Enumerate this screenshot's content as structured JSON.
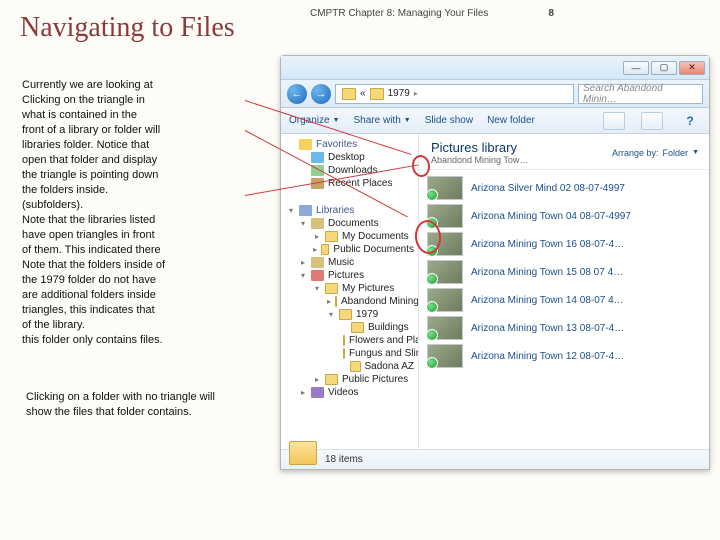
{
  "slide": {
    "chapter": "CMPTR Chapter 8: Managing Your Files",
    "page": "8",
    "title": "Navigating to Files",
    "para1": "Currently we are looking at\nClicking on the triangle in\nwhat is contained in the\nfront of a library or folder will\nlibraries folder. Notice that\nopen that folder and display\nthe triangle is pointing down\nthe folders inside.\n(subfolders).\nNote that the libraries listed\nhave open triangles in front\nof them. This indicated there\nNote that the folders inside of\nthe 1979 folder do not have\nare additional folders inside\ntriangles, this indicates that\nof the library.\nthis folder only contains files.",
    "para2": "Clicking on a folder with no triangle will show the files that folder contains."
  },
  "explorer": {
    "win_buttons": {
      "min": "—",
      "max": "▢",
      "close": "✕"
    },
    "nav": {
      "back": "←",
      "fwd": "→"
    },
    "breadcrumb": {
      "seg1": "«",
      "seg2": "1979",
      "sep": "▸"
    },
    "search_placeholder": "Search Abandond Minin…",
    "toolbar": {
      "organize": "Organize",
      "share": "Share with",
      "slideshow": "Slide show",
      "newfolder": "New folder"
    },
    "library": {
      "title": "Pictures library",
      "subtitle": "Abandond Mining Tow…",
      "arrange_label": "Arrange by:",
      "arrange_value": "Folder"
    },
    "tree": {
      "favorites": "Favorites",
      "desktop": "Desktop",
      "downloads": "Downloads",
      "recent": "Recent Places",
      "libraries": "Libraries",
      "documents": "Documents",
      "my_documents": "My Documents",
      "public_documents": "Public Documents",
      "music": "Music",
      "pictures": "Pictures",
      "my_pictures": "My Pictures",
      "az_folder": "Abandond Mining Town AZ",
      "y1979": "1979",
      "buildings": "Buildings",
      "flowers": "Flowers and Plants",
      "fungus": "Fungus and Slime",
      "sadona": "Sadona AZ",
      "public_pictures": "Public Pictures",
      "videos": "Videos"
    },
    "files": [
      "Arizona Silver Mind 02 08-07-4997",
      "Arizona Mining Town 04 08-07-4997",
      "Arizona Mining Town 16 08-07-4…",
      "Arizona Mining Town 15 08 07 4…",
      "Arizona Mining Town 14 08-07 4…",
      "Arizona Mining Town 13 08-07-4…",
      "Arizona Mining Town 12 08-07-4…"
    ],
    "status": {
      "count": "18 items"
    },
    "help": "?"
  }
}
